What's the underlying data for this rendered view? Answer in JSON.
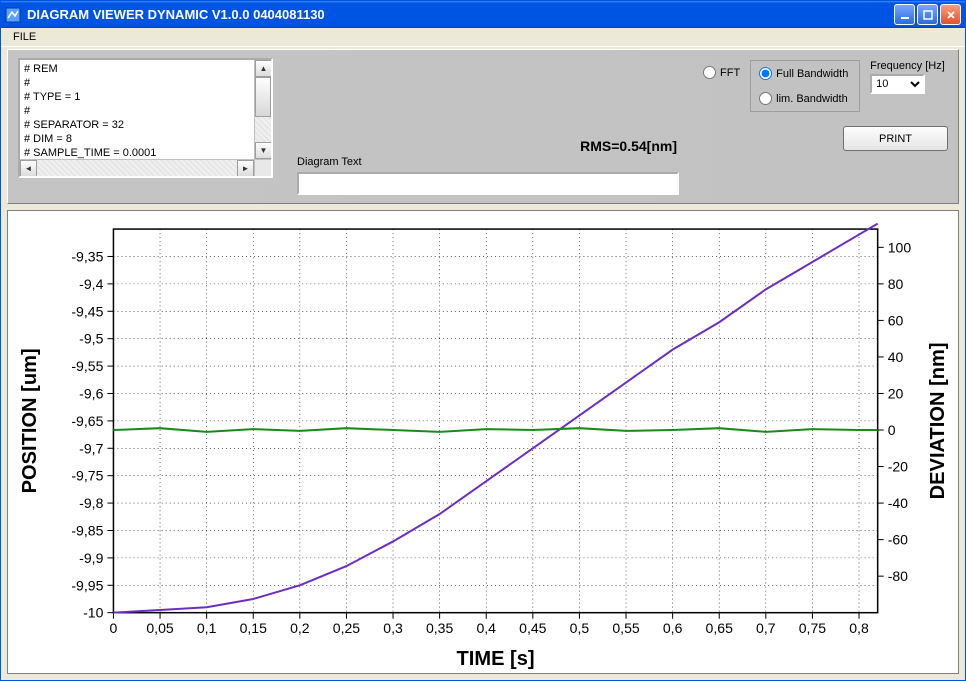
{
  "window": {
    "title": "DIAGRAM  VIEWER DYNAMIC V1.0.0 0404081130",
    "menu": {
      "file": "FILE"
    }
  },
  "header_lines": [
    "# REM",
    "#",
    "# TYPE = 1",
    "#",
    "# SEPARATOR = 32",
    "# DIM = 8",
    "# SAMPLE_TIME = 0.0001"
  ],
  "controls": {
    "diagram_text_label": "Diagram Text",
    "diagram_text_value": "",
    "rms_label": "RMS=0.54[nm]",
    "fft_label": "FFT",
    "bw_full_label": "Full Bandwidth",
    "bw_lim_label": "lim. Bandwidth",
    "bw_selected": "full",
    "frequency_label": "Frequency [Hz]",
    "frequency_value": "10",
    "print_label": "PRINT"
  },
  "chart_data": {
    "type": "line",
    "xlabel": "TIME [s]",
    "ylabel_left": "POSITION [um]",
    "ylabel_right": "DEVIATION [nm]",
    "xlim": [
      0,
      0.82
    ],
    "ylim_left": [
      -10.0,
      -9.3
    ],
    "ylim_right": [
      -100,
      110
    ],
    "x_ticks": [
      0,
      0.05,
      0.1,
      0.15,
      0.2,
      0.25,
      0.3,
      0.35,
      0.4,
      0.45,
      0.5,
      0.55,
      0.6,
      0.65,
      0.7,
      0.75,
      0.8
    ],
    "x_tick_labels": [
      "0",
      "0,05",
      "0,1",
      "0,15",
      "0,2",
      "0,25",
      "0,3",
      "0,35",
      "0,4",
      "0,45",
      "0,5",
      "0,55",
      "0,6",
      "0,65",
      "0,7",
      "0,75",
      "0,8"
    ],
    "y_left_ticks": [
      -10,
      -9.95,
      -9.9,
      -9.85,
      -9.8,
      -9.75,
      -9.7,
      -9.65,
      -9.6,
      -9.55,
      -9.5,
      -9.45,
      -9.4,
      -9.35
    ],
    "y_left_tick_labels": [
      "-10",
      "-9,95",
      "-9,9",
      "-9,85",
      "-9,8",
      "-9,75",
      "-9,7",
      "-9,65",
      "-9,6",
      "-9,55",
      "-9,5",
      "-9,45",
      "-9,4",
      "-9,35"
    ],
    "y_right_ticks": [
      -80,
      -60,
      -40,
      -20,
      0,
      20,
      40,
      60,
      80,
      100
    ],
    "y_right_tick_labels": [
      "-80",
      "-60",
      "-40",
      "-20",
      "0",
      "20",
      "40",
      "60",
      "80",
      "100"
    ],
    "series": [
      {
        "name": "POSITION",
        "axis": "left",
        "color": "#6a2fbf",
        "x": [
          0.0,
          0.05,
          0.1,
          0.15,
          0.2,
          0.25,
          0.3,
          0.35,
          0.4,
          0.45,
          0.5,
          0.55,
          0.6,
          0.65,
          0.7,
          0.75,
          0.8,
          0.82
        ],
        "y": [
          -10.0,
          -9.995,
          -9.99,
          -9.975,
          -9.95,
          -9.915,
          -9.87,
          -9.82,
          -9.76,
          -9.7,
          -9.64,
          -9.58,
          -9.52,
          -9.47,
          -9.41,
          -9.36,
          -9.31,
          -9.29
        ]
      },
      {
        "name": "DEVIATION",
        "axis": "right",
        "color": "#1a8a1a",
        "x": [
          0.0,
          0.05,
          0.1,
          0.15,
          0.2,
          0.25,
          0.3,
          0.35,
          0.4,
          0.45,
          0.5,
          0.55,
          0.6,
          0.65,
          0.7,
          0.75,
          0.8,
          0.82
        ],
        "y": [
          0,
          1,
          -1,
          0.5,
          -0.5,
          1,
          0,
          -1,
          0.5,
          0,
          1,
          -0.5,
          0,
          1,
          -1,
          0.5,
          0,
          0
        ]
      }
    ]
  }
}
